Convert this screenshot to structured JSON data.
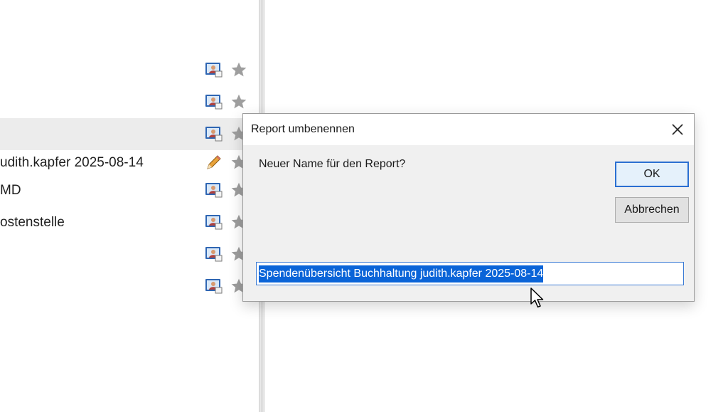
{
  "report_list": {
    "rows": [
      {
        "label": "",
        "icon": "report-icon",
        "favorite": false,
        "selected": false
      },
      {
        "label": "",
        "icon": "report-icon",
        "favorite": false,
        "selected": false
      },
      {
        "label": "",
        "icon": "report-icon",
        "favorite": false,
        "selected": true
      },
      {
        "label": "udith.kapfer 2025-08-14",
        "icon": "pencil-icon",
        "favorite": false,
        "selected": false
      },
      {
        "label": "MD",
        "icon": "report-icon",
        "favorite": false,
        "selected": false
      },
      {
        "label": "ostenstelle",
        "icon": "report-icon",
        "favorite": false,
        "selected": false
      },
      {
        "label": "",
        "icon": "report-icon",
        "favorite": false,
        "selected": false
      },
      {
        "label": "",
        "icon": "report-icon",
        "favorite": false,
        "selected": false
      }
    ]
  },
  "dialog": {
    "title": "Report umbenennen",
    "prompt": "Neuer Name für den Report?",
    "ok_label": "OK",
    "cancel_label": "Abbrechen",
    "input_value": "Spendenübersicht Buchhaltung judith.kapfer 2025-08-14"
  },
  "colors": {
    "selection": "#0a64d8",
    "focus_border": "#2b6fd1",
    "dialog_bg": "#f0f0f0",
    "selected_row": "#ececec",
    "star": "#9e9e9e"
  }
}
